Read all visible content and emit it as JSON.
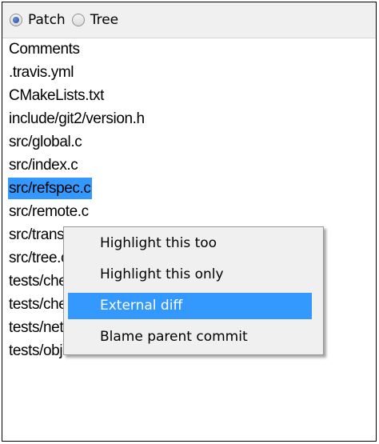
{
  "toolbar": {
    "patch_label": "Patch",
    "tree_label": "Tree",
    "selected": "patch"
  },
  "files": {
    "items": [
      "Comments",
      ".travis.yml",
      "CMakeLists.txt",
      "include/git2/version.h",
      "src/global.c",
      "src/index.c",
      "src/refspec.c",
      "src/remote.c",
      "src/transport.c",
      "src/tree.c",
      "tests/cherrypick/workdir.c",
      "tests/cherrypick/workdir.c",
      "tests/network/refspecs.c",
      "tests/object/tree/write.c"
    ],
    "selected_index": 6
  },
  "context_menu": {
    "items": [
      "Highlight this too",
      "Highlight this only",
      "External diff",
      "Blame parent commit"
    ],
    "active_index": 2
  },
  "colors": {
    "selection": "#3399ff",
    "menu_bg": "#f0f0f0"
  }
}
